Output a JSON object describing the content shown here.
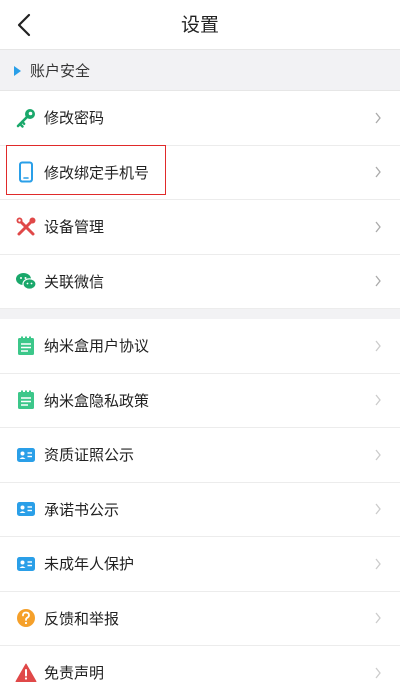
{
  "header": {
    "title": "设置"
  },
  "section": {
    "label": "账户安全"
  },
  "group1": [
    {
      "label": "修改密码",
      "icon": "key-icon"
    },
    {
      "label": "修改绑定手机号",
      "icon": "phone-icon"
    },
    {
      "label": "设备管理",
      "icon": "tools-icon"
    },
    {
      "label": "关联微信",
      "icon": "wechat-icon"
    }
  ],
  "group2": [
    {
      "label": "纳米盒用户协议",
      "icon": "notepad-icon"
    },
    {
      "label": "纳米盒隐私政策",
      "icon": "notepad-icon"
    },
    {
      "label": "资质证照公示",
      "icon": "id-card-icon"
    },
    {
      "label": "承诺书公示",
      "icon": "id-card-icon"
    },
    {
      "label": "未成年人保护",
      "icon": "id-card-icon"
    },
    {
      "label": "反馈和举报",
      "icon": "question-icon"
    },
    {
      "label": "免责声明",
      "icon": "warning-icon"
    }
  ],
  "colors": {
    "accent": "#2a9fe8",
    "green": "#1aa86b",
    "red": "#e04848",
    "orange": "#f5a02a",
    "highlight": "#e02a2a"
  }
}
